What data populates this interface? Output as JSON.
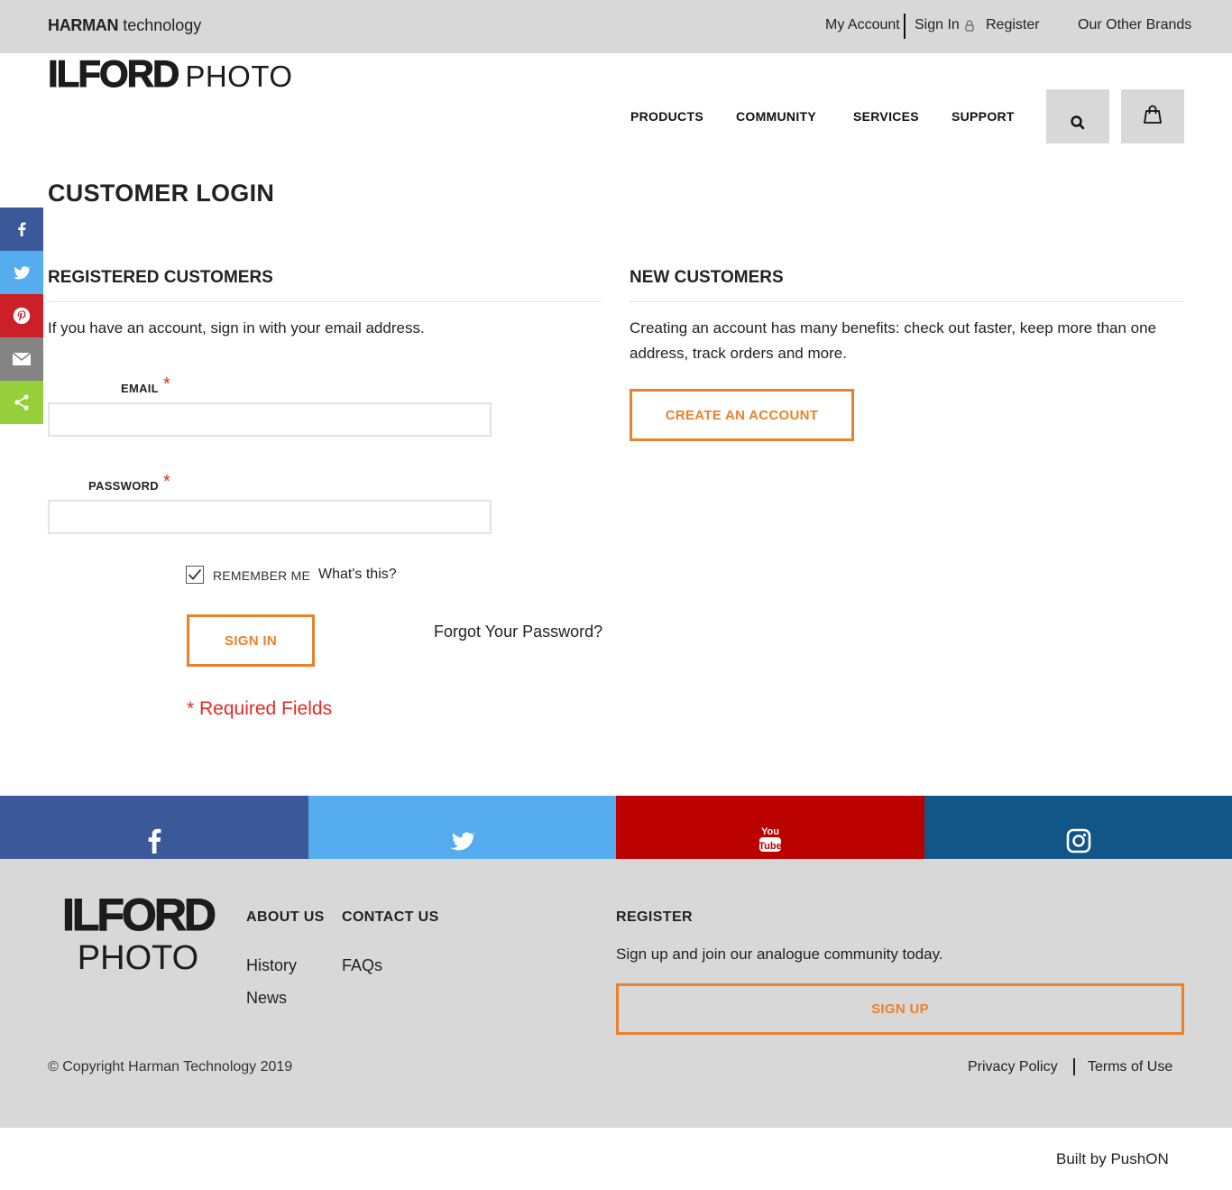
{
  "topbar": {
    "brand_bold": "HARMAN",
    "brand_light": "technology",
    "my_account": "My Account",
    "sign_in": "Sign In",
    "register": "Register",
    "other_brands": "Our Other Brands"
  },
  "header": {
    "logo_main": "ILFORD",
    "logo_sub": "PHOTO",
    "nav": [
      "PRODUCTS",
      "COMMUNITY",
      "SERVICES",
      "SUPPORT"
    ]
  },
  "share_rail": [
    "facebook-icon",
    "twitter-icon",
    "pinterest-icon",
    "email-icon",
    "share-icon"
  ],
  "page": {
    "title": "CUSTOMER LOGIN",
    "registered": {
      "heading": "REGISTERED CUSTOMERS",
      "intro": "If you have an account, sign in with your email address.",
      "email_label": "EMAIL",
      "password_label": "PASSWORD",
      "required_mark": "*",
      "email_value": "",
      "password_value": "",
      "remember_label": "REMEMBER ME",
      "remember_checked": true,
      "whats_this": "What's this?",
      "sign_in_button": "SIGN IN",
      "forgot": "Forgot Your Password?",
      "required_note": "* Required Fields"
    },
    "new_customers": {
      "heading": "NEW CUSTOMERS",
      "text": "Creating an account has many benefits: check out faster, keep more than one address, track orders and more.",
      "create_button": "CREATE AN ACCOUNT"
    }
  },
  "social_band": [
    {
      "icon": "facebook-icon",
      "color": "#3b5998"
    },
    {
      "icon": "twitter-icon",
      "color": "#55acee"
    },
    {
      "icon": "youtube-icon",
      "color": "#bb0000"
    },
    {
      "icon": "instagram-icon",
      "color": "#125688"
    }
  ],
  "footer": {
    "logo_main": "ILFORD",
    "logo_sub": "PHOTO",
    "about_heading": "ABOUT US",
    "contact_heading": "CONTACT US",
    "about_links": [
      "History",
      "News"
    ],
    "contact_links": [
      "FAQs"
    ],
    "register_heading": "REGISTER",
    "register_text": "Sign up and join our analogue community today.",
    "sign_up_button": "SIGN UP",
    "copyright": "© Copyright Harman Technology 2019",
    "privacy": "Privacy Policy",
    "terms": "Terms of Use",
    "built_by": "Built by PushON"
  },
  "colors": {
    "accent": "#e8822d",
    "error": "#e02b27",
    "bar_grey": "#d9d8d8"
  }
}
